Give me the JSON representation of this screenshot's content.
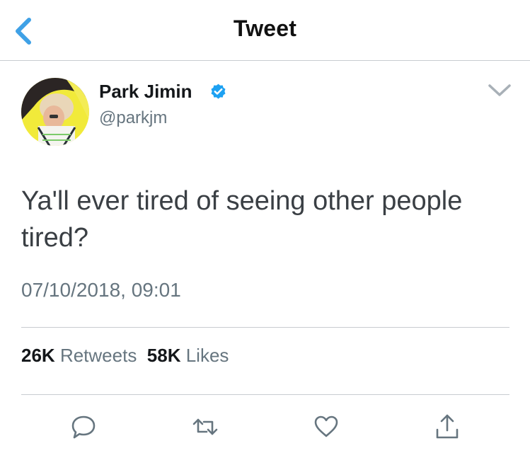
{
  "header": {
    "title": "Tweet",
    "back_icon": "chevron-left-icon",
    "accent_color": "#3fa1e6"
  },
  "tweet": {
    "author": {
      "display_name": "Park Jimin",
      "handle": "@parkjm",
      "verified": true,
      "verified_icon": "verified-badge-icon"
    },
    "menu_icon": "chevron-down-icon",
    "text": "Ya'll ever tired of seeing other people tired?",
    "timestamp": "07/10/2018, 09:01",
    "stats": {
      "retweets_count": "26K",
      "retweets_label": "Retweets",
      "likes_count": "58K",
      "likes_label": "Likes"
    }
  },
  "actions": [
    {
      "name": "reply",
      "icon": "speech-bubble-icon"
    },
    {
      "name": "retweet",
      "icon": "retweet-icon"
    },
    {
      "name": "like",
      "icon": "heart-icon"
    },
    {
      "name": "share",
      "icon": "share-icon"
    }
  ],
  "colors": {
    "icon_gray": "#66757f",
    "divider": "#c8ccd0",
    "verified_blue": "#1da1f2"
  }
}
